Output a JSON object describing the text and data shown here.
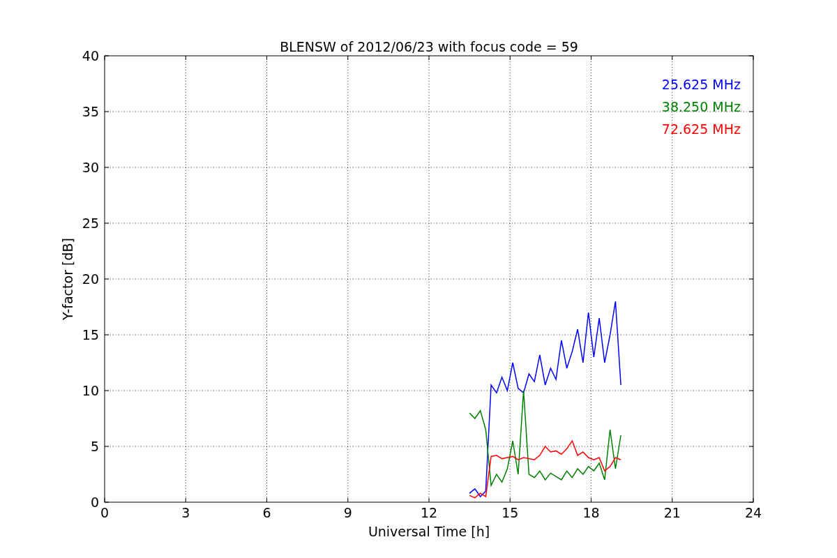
{
  "chart_data": {
    "type": "line",
    "title": "BLENSW of 2012/06/23 with focus code = 59",
    "xlabel": "Universal Time [h]",
    "ylabel": "Y-factor [dB]",
    "x": [
      13.5,
      13.7,
      13.9,
      14.1,
      14.3,
      14.5,
      14.7,
      14.9,
      15.1,
      15.3,
      15.5,
      15.7,
      15.9,
      16.1,
      16.3,
      16.5,
      16.7,
      16.9,
      17.1,
      17.3,
      17.5,
      17.7,
      17.9,
      18.1,
      18.3,
      18.5,
      18.7,
      18.9,
      19.1
    ],
    "series": [
      {
        "name": "25.625 MHz",
        "color": "#0000ff",
        "values": [
          0.8,
          1.2,
          0.5,
          1.0,
          10.5,
          9.8,
          11.2,
          10.0,
          12.5,
          10.2,
          9.8,
          11.5,
          10.8,
          13.2,
          10.5,
          12.0,
          11.0,
          14.5,
          12.0,
          13.5,
          15.5,
          12.5,
          17.0,
          13.0,
          16.5,
          12.5,
          15.0,
          18.0,
          10.5
        ]
      },
      {
        "name": "38.250 MHz",
        "color": "#008000",
        "values": [
          8.0,
          7.5,
          8.2,
          6.5,
          1.5,
          2.5,
          1.8,
          3.0,
          5.5,
          2.5,
          10.0,
          2.5,
          2.2,
          2.8,
          2.0,
          2.6,
          2.3,
          2.0,
          2.8,
          2.2,
          3.0,
          2.5,
          3.2,
          2.8,
          3.5,
          2.0,
          6.5,
          3.0,
          6.0
        ]
      },
      {
        "name": "72.625 MHz",
        "color": "#ff0000",
        "values": [
          0.6,
          0.4,
          0.8,
          0.5,
          4.1,
          4.2,
          3.9,
          4.0,
          4.1,
          3.8,
          4.0,
          3.9,
          3.8,
          4.2,
          5.0,
          4.5,
          4.6,
          4.3,
          4.8,
          5.5,
          4.2,
          4.5,
          4.0,
          3.8,
          4.0,
          2.8,
          3.2,
          4.0,
          3.8
        ]
      }
    ],
    "grid": true,
    "xlim": [
      0,
      24
    ],
    "ylim": [
      0,
      40
    ],
    "xticks": [
      0,
      3,
      6,
      9,
      12,
      15,
      18,
      21,
      24
    ],
    "yticks": [
      0,
      5,
      10,
      15,
      20,
      25,
      30,
      35,
      40
    ]
  }
}
